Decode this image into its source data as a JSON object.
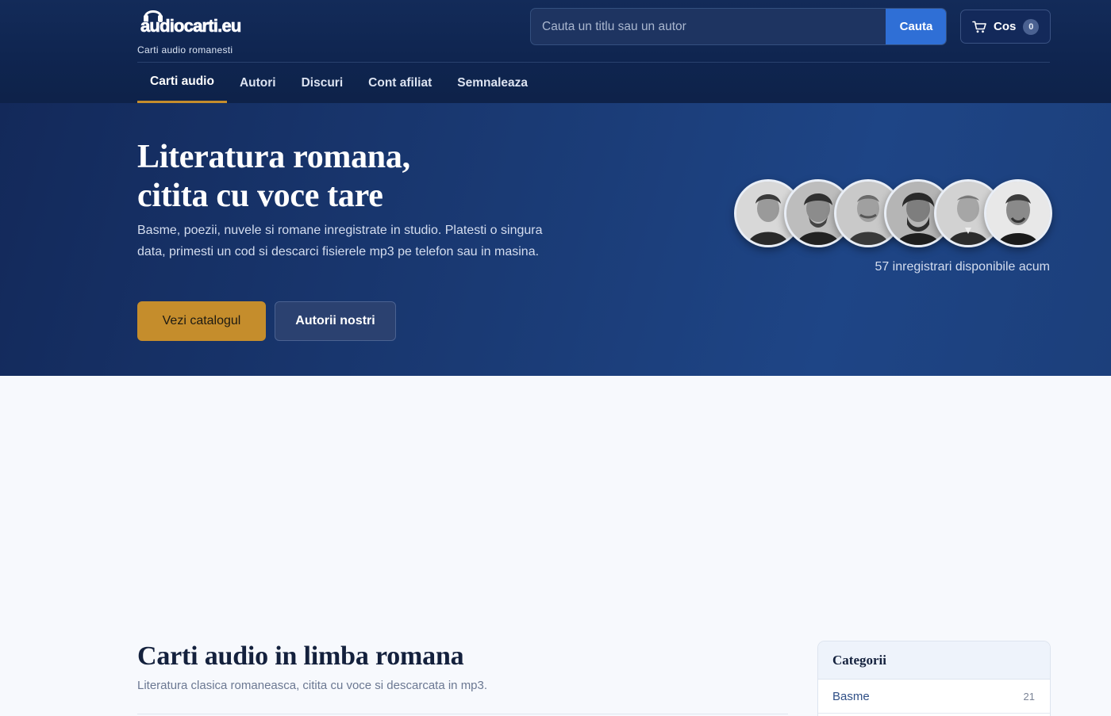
{
  "brand": {
    "logo_text": "audiocarti.eu",
    "tagline": "Carti audio romanesti"
  },
  "search": {
    "placeholder": "Cauta un titlu sau un autor",
    "button_label": "Cauta"
  },
  "cart": {
    "label": "Cos",
    "count": "0"
  },
  "nav": {
    "items": [
      {
        "label": "Carti audio",
        "active": true
      },
      {
        "label": "Autori"
      },
      {
        "label": "Discuri"
      },
      {
        "label": "Cont afiliat"
      },
      {
        "label": "Semnaleaza"
      }
    ]
  },
  "hero": {
    "title_line1": "Literatura romana,",
    "title_line2": "citita cu voce tare",
    "subtitle": "Basme, poezii, nuvele si romane inregistrate in studio. Platesti o singura data, primesti un cod si descarci fisierele mp3 pe telefon sau in masina.",
    "primary_button": "Vezi catalogul",
    "secondary_button": "Autorii nostri",
    "recordings_count": "57 inregistrari disponibile acum"
  },
  "main": {
    "title": "Carti audio in limba romana",
    "subtitle": "Literatura clasica romaneasca, citita cu voce si descarcata in mp3."
  },
  "categories": {
    "heading": "Categorii",
    "items": [
      {
        "name": "Basme",
        "count": "21"
      }
    ]
  },
  "colors": {
    "header_bg": "#0f2550",
    "accent_gold": "#c58d2c",
    "search_blue": "#2f6fd6",
    "page_bg": "#f7f9fd"
  }
}
